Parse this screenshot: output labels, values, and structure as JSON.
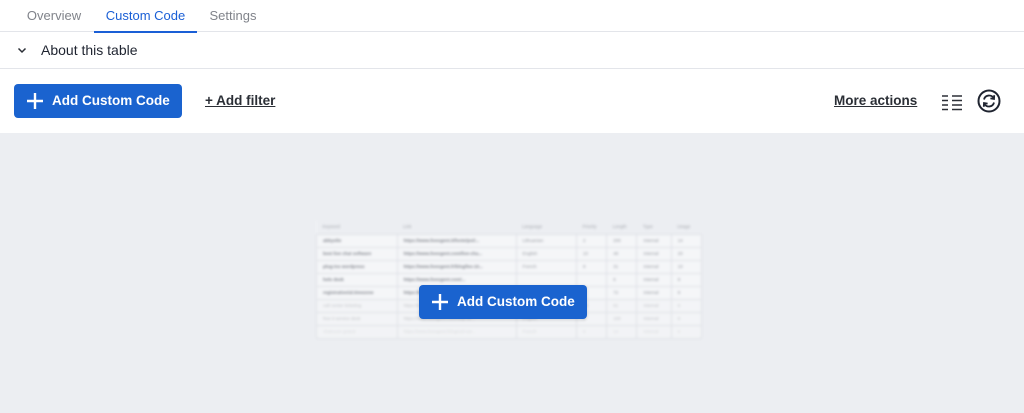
{
  "tabs": [
    {
      "label": "Overview",
      "active": false
    },
    {
      "label": "Custom Code",
      "active": true
    },
    {
      "label": "Settings",
      "active": false
    }
  ],
  "about": {
    "label": "About this table",
    "icon": "chevron-down-icon"
  },
  "toolbar": {
    "add_button_label": "Add Custom Code",
    "add_filter_label": "+ Add filter",
    "more_actions_label": "More actions",
    "view_icon": "list-view-icon",
    "refresh_icon": "refresh-icon"
  },
  "empty_state": {
    "button_label": "Add Custom Code",
    "preview_headers": [
      "Keyword",
      "Link",
      "Language",
      "Priority",
      "Length",
      "Type",
      "Usage"
    ],
    "preview_rows": [
      [
        "abbyolie",
        "https://www.livesgent.it/fonte/poi/...",
        "Lithuanian",
        "2",
        "200",
        "Internal",
        "14"
      ],
      [
        "best live chat software",
        "https://www.livesgent.com/live-cha...",
        "English",
        "10",
        "48",
        "Internal",
        "20"
      ],
      [
        "plug-ins wordpress",
        "https://www.livesgent.fr/blog/les-10...",
        "French",
        "8",
        "31",
        "Internal",
        "10"
      ],
      [
        "helo desk",
        "https://www.livesgent.com/...",
        "",
        "",
        "6",
        "Internal",
        "8"
      ],
      [
        "registration/al.timezone",
        "https://www.livesgent.com/...",
        "",
        "",
        "72",
        "Internal",
        "8"
      ],
      [
        "call center ticketing",
        "https://www.livesgent.com/ticketsm...",
        "English",
        "10",
        "61",
        "Internal",
        "6"
      ],
      [
        "free it service desk",
        "https://www.livesgent.com/help-se...",
        "English",
        "6",
        "100",
        "Internal",
        "6"
      ],
      [
        "chatroom gratuit",
        "https://www.livesgent.fr/logiciel-ser...",
        "French",
        "6",
        "14",
        "Internal",
        "6"
      ]
    ]
  },
  "colors": {
    "accent": "#1a63cf",
    "tab_active": "#1a5fd6",
    "content_bg": "#eceef2"
  }
}
